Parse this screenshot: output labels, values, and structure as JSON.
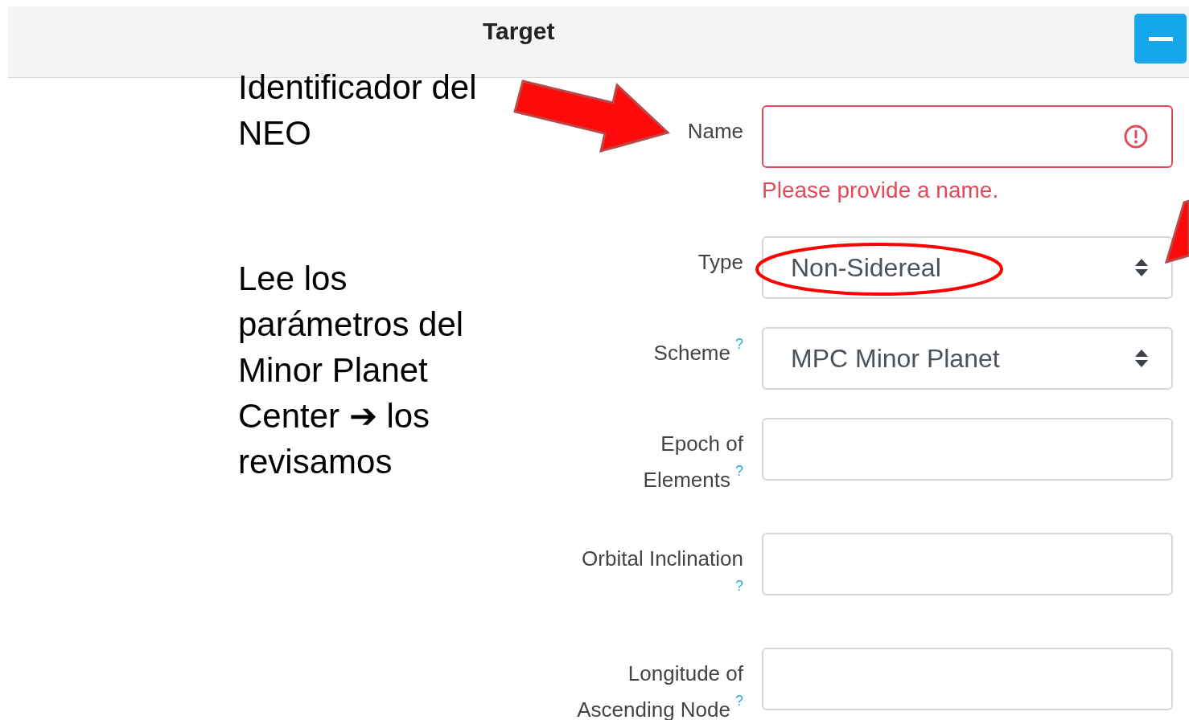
{
  "header": {
    "title": "Target"
  },
  "annotations": [
    {
      "text": "Identificador del NEO"
    },
    {
      "text": "Lee los parámetros del Minor Planet Center ➔ los revisamos"
    }
  ],
  "fields": [
    {
      "kind": "text",
      "label": [
        "Name"
      ],
      "invalid": true,
      "error": "Please provide a name."
    },
    {
      "kind": "select",
      "label": [
        "Type"
      ],
      "value": "Non-Sidereal",
      "invalid": false,
      "highlighted": true
    },
    {
      "kind": "select",
      "label": [
        "Scheme"
      ],
      "help": "?",
      "value": "MPC Minor Planet",
      "invalid": false
    },
    {
      "kind": "text",
      "label": [
        "Epoch of",
        "Elements"
      ],
      "help": "?",
      "invalid": false
    },
    {
      "kind": "text",
      "label": [
        "Orbital Inclination"
      ],
      "help": "?",
      "help_below": true,
      "invalid": false
    },
    {
      "kind": "text",
      "label": [
        "Longitude of",
        "Ascending Node"
      ],
      "help": "?",
      "invalid": false
    }
  ]
}
